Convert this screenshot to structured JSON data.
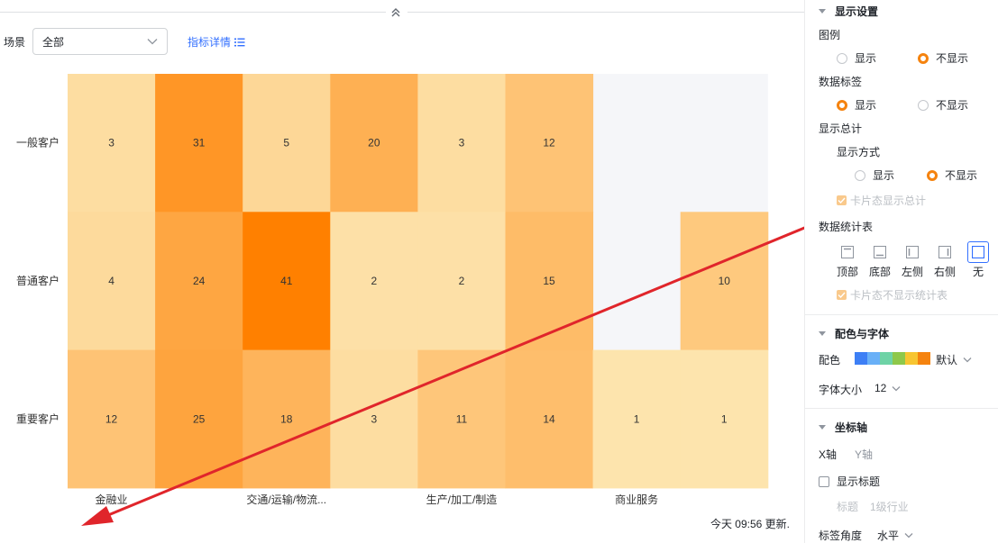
{
  "filter": {
    "scene_label": "场景",
    "scene_value": "全部",
    "detail_link": "指标详情"
  },
  "chart_data": {
    "type": "heatmap",
    "rows": [
      "一般客户",
      "普通客户",
      "重要客户"
    ],
    "columns": [
      "金融业",
      "",
      "交通/运输/物流...",
      "",
      "生产/加工/制造",
      "",
      "商业服务",
      ""
    ],
    "x_tick_labels": [
      "金融业",
      "交通/运输/物流...",
      "生产/加工/制造",
      "商业服务"
    ],
    "values": [
      [
        3,
        31,
        5,
        20,
        3,
        12,
        null,
        null
      ],
      [
        4,
        24,
        41,
        2,
        2,
        15,
        null,
        10
      ],
      [
        12,
        25,
        18,
        3,
        11,
        14,
        1,
        1
      ]
    ],
    "color_low": "#fde8b5",
    "color_high": "#ff8000",
    "empty_color": "#f5f6f9",
    "legend": "none",
    "data_labels": true
  },
  "footer": {
    "updated_text": "今天 09:56 更新."
  },
  "panel": {
    "display": {
      "title": "显示设置",
      "legend_label": "图例",
      "legend_show": "显示",
      "legend_hide": "不显示",
      "data_label_label": "数据标签",
      "data_label_show": "显示",
      "data_label_hide": "不显示",
      "total_label": "显示总计",
      "mode_label": "显示方式",
      "mode_show": "显示",
      "mode_hide": "不显示",
      "card_total": "卡片态显示总计",
      "stats_label": "数据统计表",
      "pos_top": "顶部",
      "pos_bottom": "底部",
      "pos_left": "左侧",
      "pos_right": "右侧",
      "pos_none": "无",
      "card_no_stats": "卡片态不显示统计表"
    },
    "color_font": {
      "title": "配色与字体",
      "color_label": "配色",
      "color_value": "默认",
      "palette": [
        "#3d7ff5",
        "#69b0f7",
        "#6ed3a6",
        "#8ec84a",
        "#f7c531",
        "#f5830f"
      ],
      "font_size_label": "字体大小",
      "font_size_value": "12"
    },
    "axis": {
      "title": "坐标轴",
      "x_tab": "X轴",
      "y_tab": "Y轴",
      "show_title": "显示标题",
      "title_label": "标题",
      "title_placeholder": "1级行业",
      "angle_label": "标签角度",
      "angle_value": "水平"
    }
  },
  "colors": {
    "accent_orange": "#f5830f",
    "link_blue": "#3370ff",
    "annotation_red": "#e0252b"
  }
}
